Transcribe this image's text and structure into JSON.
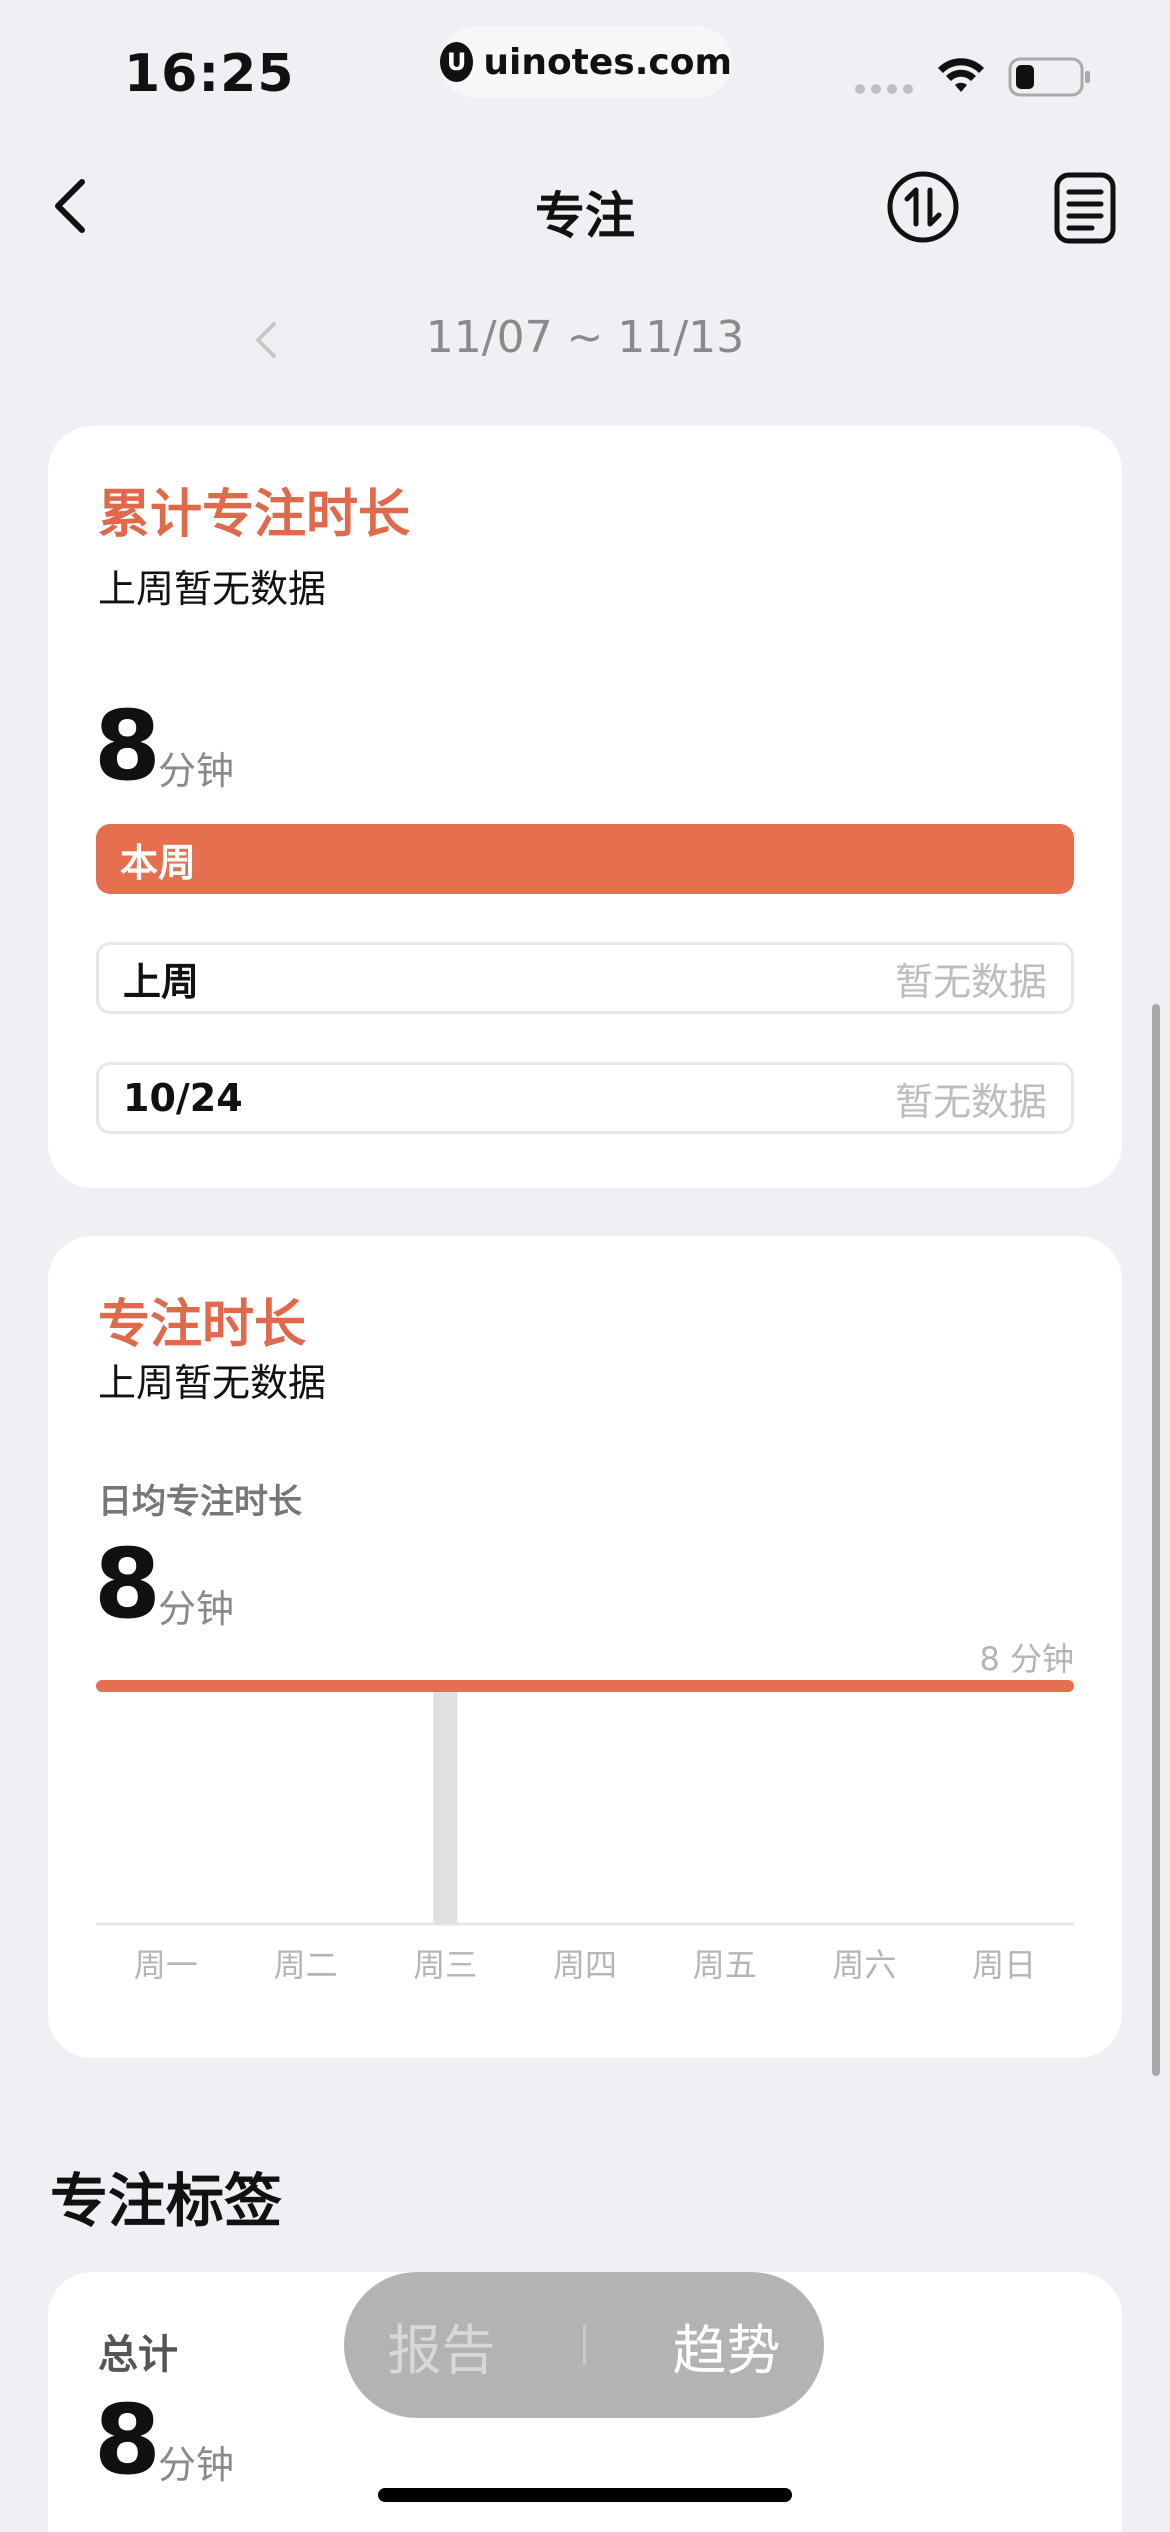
{
  "status_bar": {
    "time": "16:25",
    "url": "uinotes.com",
    "url_logo_letter": "U"
  },
  "nav": {
    "title": "专注",
    "icons": [
      "back-icon",
      "sort-icon",
      "document-icon"
    ]
  },
  "week": {
    "range": "11/07 ~ 11/13"
  },
  "cumulative_card": {
    "title": "累计专注时长",
    "subtitle": "上周暂无数据",
    "total": "8",
    "unit": "分钟",
    "rows": [
      {
        "label": "本周",
        "value": ""
      },
      {
        "label": "上周",
        "value": "暂无数据"
      },
      {
        "label": "10/24",
        "value": "暂无数据"
      }
    ]
  },
  "duration_card": {
    "title": "专注时长",
    "subtitle": "上周暂无数据",
    "avg_label": "日均专注时长",
    "avg_value": "8",
    "unit": "分钟",
    "chart_data": {
      "type": "bar",
      "categories": [
        "周一",
        "周二",
        "周三",
        "周四",
        "周五",
        "周六",
        "周日"
      ],
      "values": [
        0,
        0,
        8,
        0,
        0,
        0,
        0
      ],
      "reference_line": {
        "value": 8,
        "label": "8 分钟"
      },
      "ylim": [
        0,
        8
      ],
      "colors": {
        "bar": "#e0e0e0",
        "reference": "#e66f4f",
        "axis": "#e6e6e6",
        "tick": "#b5b5b5"
      }
    }
  },
  "tags_section": {
    "title": "专注标签"
  },
  "tags_card": {
    "total_label": "总计",
    "total_value": "8",
    "unit": "分钟"
  },
  "bottom_tabs": {
    "report": "报告",
    "trend": "趋势"
  },
  "colors": {
    "accent": "#e66f4f",
    "background": "#f0f0f4"
  }
}
